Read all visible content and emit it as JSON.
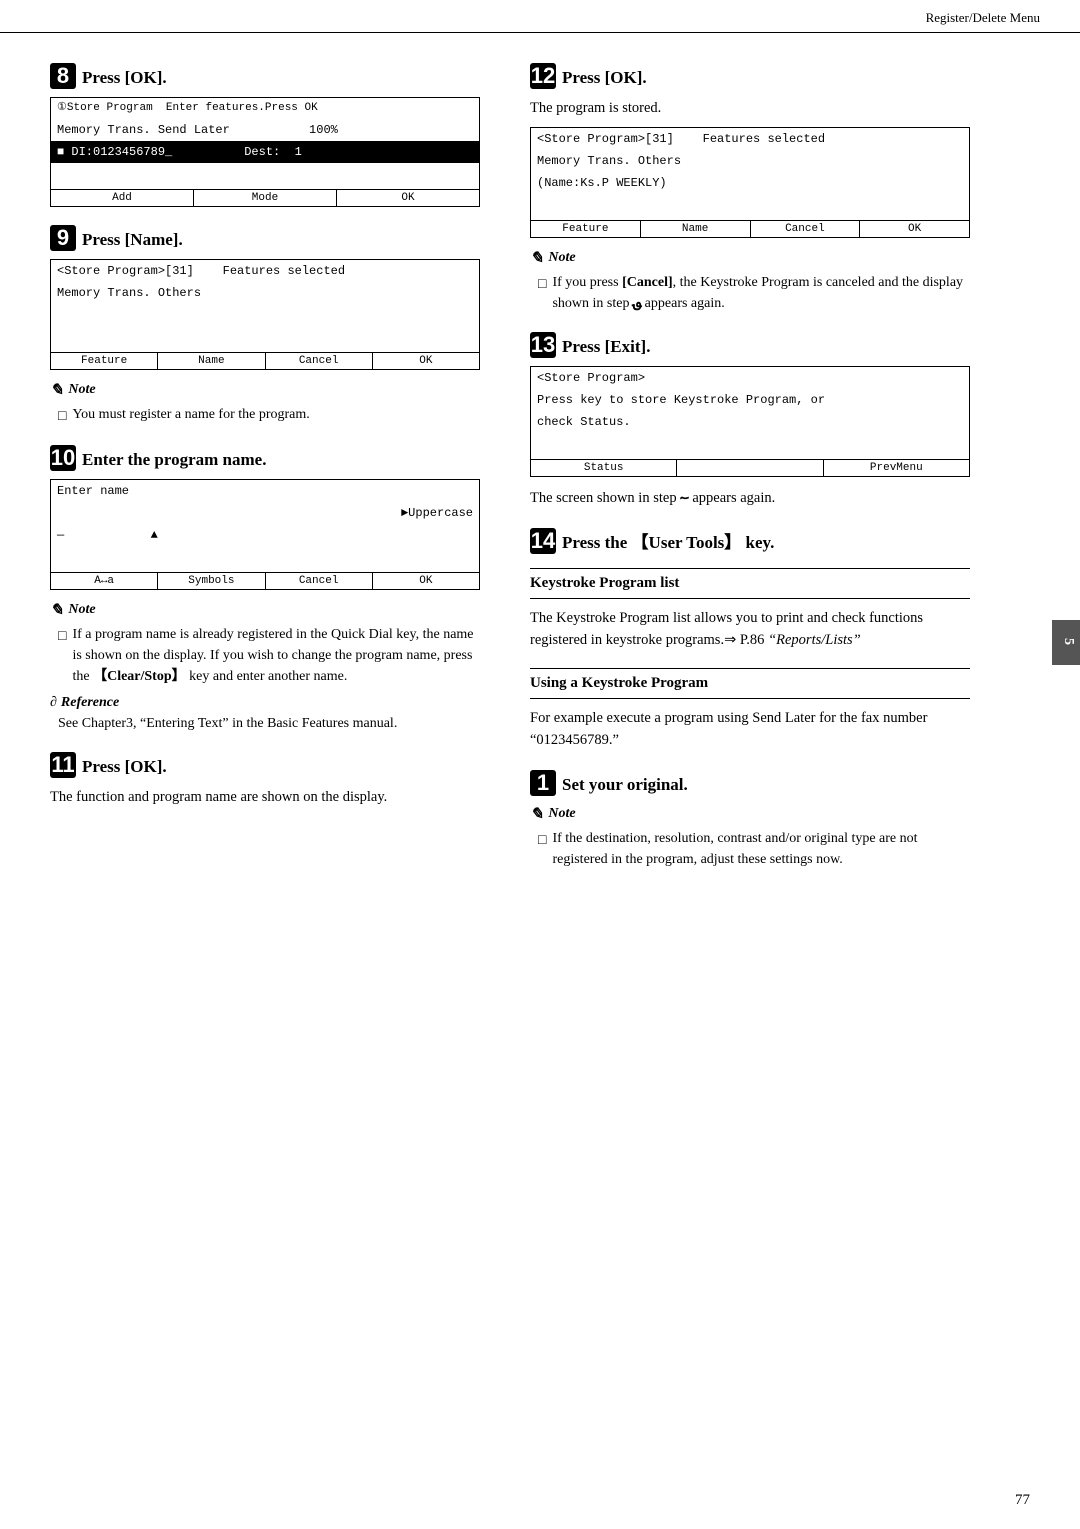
{
  "header": {
    "title": "Register/Delete Menu"
  },
  "page_number": "77",
  "side_tab": "5",
  "left_col": {
    "step8": {
      "number": "8",
      "title": "Press [OK].",
      "screen": {
        "rows": [
          {
            "text": "①Store Program  Enter features.Press OK",
            "highlight": false
          },
          {
            "text": "Memory Trans. Send Later           100%",
            "highlight": false
          },
          {
            "text": "Ĉł_ DI:0123456789_          Dest:  1",
            "highlight": true
          },
          {
            "text": "",
            "highlight": false
          }
        ],
        "buttons": [
          "Add",
          "Mode",
          "OK"
        ]
      }
    },
    "step9": {
      "number": "9",
      "title": "Press [Name].",
      "screen": {
        "rows": [
          {
            "text": "<Store Program>[31]    Features selected",
            "highlight": false
          },
          {
            "text": "Memory Trans. Others",
            "highlight": false
          },
          {
            "text": "",
            "highlight": false
          },
          {
            "text": "",
            "highlight": false
          }
        ],
        "buttons": [
          "Feature",
          "Name",
          "Cancel",
          "OK"
        ]
      },
      "note": {
        "header": "Note",
        "items": [
          "You must register a name for the program."
        ]
      }
    },
    "step10": {
      "number": "10",
      "title": "Enter the program name.",
      "screen": {
        "rows": [
          {
            "text": "Enter name",
            "highlight": false
          },
          {
            "text": "                              ►Uppercase",
            "highlight": false
          },
          {
            "text": "—           ▲",
            "highlight": false
          },
          {
            "text": "",
            "highlight": false
          }
        ],
        "buttons": [
          "A↔a",
          "Symbols",
          "Cancel",
          "OK"
        ]
      },
      "note": {
        "header": "Note",
        "items": [
          "If a program name is already registered in the Quick Dial key, the name is shown on the display. If you wish to change the program name, press the 【Clear/Stop】 key and enter another name."
        ]
      },
      "reference": {
        "header": "Reference",
        "text": "See Chapter3, “Entering Text” in the Basic Features manual."
      }
    },
    "step11": {
      "number": "11",
      "title": "Press [OK].",
      "body": "The function and program name are shown on the display."
    }
  },
  "right_col": {
    "step12": {
      "number": "12",
      "title": "Press [OK].",
      "body": "The program is stored.",
      "screen": {
        "rows": [
          {
            "text": "<Store Program>[31]    Features selected",
            "highlight": false
          },
          {
            "text": "Memory Trans. Others",
            "highlight": false
          },
          {
            "text": "(Name:Ks.P WEEKLY)",
            "highlight": false
          },
          {
            "text": "",
            "highlight": false
          }
        ],
        "buttons": [
          "Feature",
          "Name",
          "Cancel",
          "OK"
        ]
      },
      "note": {
        "header": "Note",
        "items": [
          "If you press [Cancel], the Keystroke Program is canceled and the display shown in step ؈ appears again."
        ]
      }
    },
    "step13": {
      "number": "13",
      "title": "Press [Exit].",
      "screen": {
        "rows": [
          {
            "text": "<Store Program>",
            "highlight": false
          },
          {
            "text": "Press key to store Keystroke Program, or",
            "highlight": false
          },
          {
            "text": "check Status.",
            "highlight": false
          },
          {
            "text": "",
            "highlight": false
          }
        ],
        "buttons": [
          "Status",
          "",
          "PrevMenu"
        ]
      },
      "body": "The screen shown in step ؅ appears again."
    },
    "step14": {
      "number": "14",
      "title": "Press the 【User Tools】 key."
    },
    "keystroke_section": {
      "divider_title": "Keystroke Program list",
      "body": "The Keystroke Program list allows you to print and check functions registered in keystroke programs.⇒ P.86 “Reports/Lists”"
    },
    "using_section": {
      "divider_title": "Using a Keystroke Program",
      "body": "For example execute a program using Send Later for the fax number “0123456789.”"
    },
    "step1_using": {
      "number": "1",
      "title": "Set your original.",
      "note": {
        "header": "Note",
        "items": [
          "If the destination, resolution, contrast and/or original type are not registered in the program, adjust these settings now."
        ]
      }
    }
  }
}
